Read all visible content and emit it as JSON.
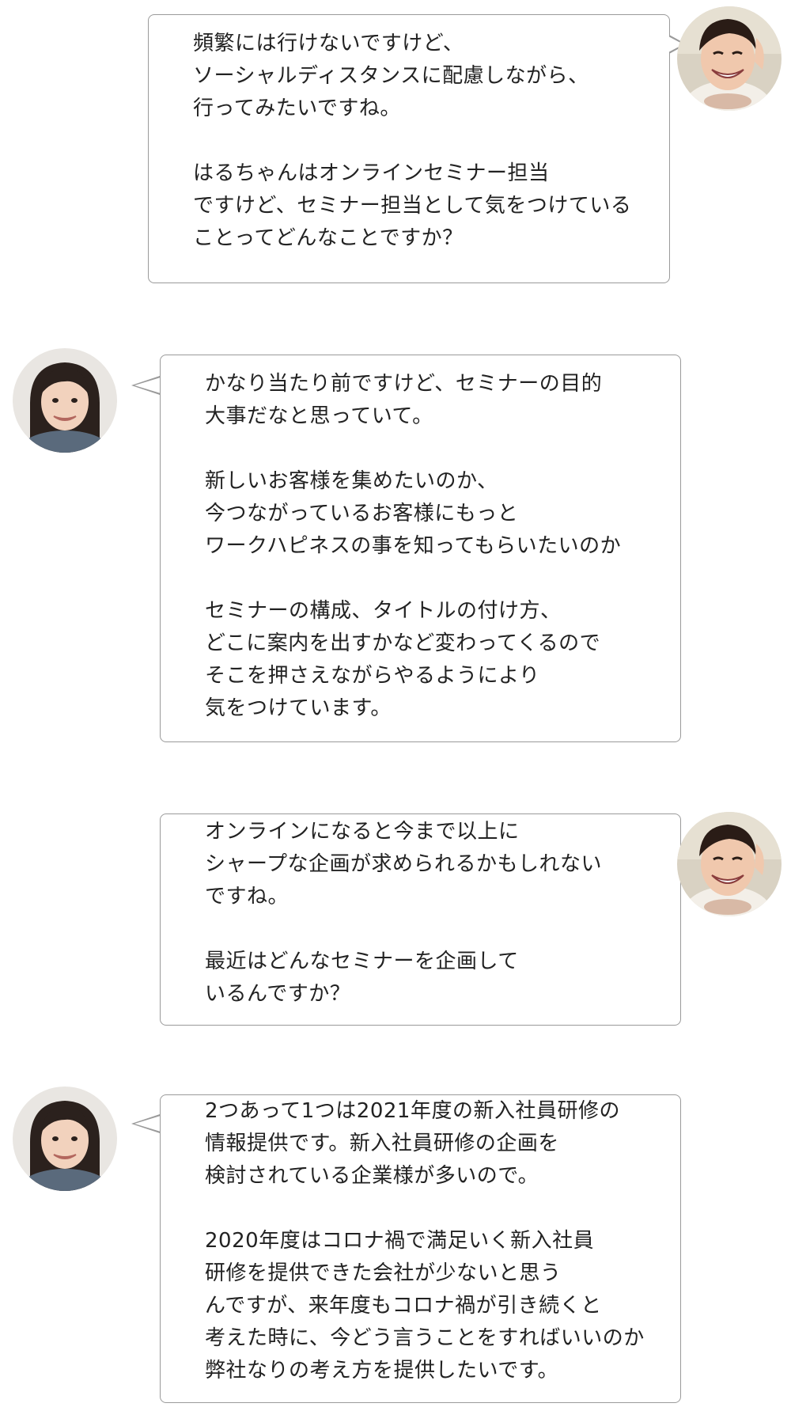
{
  "messages": [
    {
      "speaker": "interviewer",
      "lines": [
        "頻繁には行けないですけど、",
        "ソーシャルディスタンスに配慮しながら、",
        "行ってみたいですね。",
        "",
        "はるちゃんはオンラインセミナー担当",
        "ですけど、セミナー担当として気をつけている",
        "ことってどんなことですか？"
      ]
    },
    {
      "speaker": "haru",
      "lines": [
        "かなり当たり前ですけど、セミナーの目的",
        "大事だなと思っていて。",
        "",
        "新しいお客様を集めたいのか、",
        "今つながっているお客様にもっと",
        "ワークハピネスの事を知ってもらいたいのか",
        "",
        "セミナーの構成、タイトルの付け方、",
        "どこに案内を出すかなど変わってくるので",
        "そこを押さえながらやるようにより",
        "気をつけています。"
      ]
    },
    {
      "speaker": "interviewer",
      "lines": [
        "オンラインになると今まで以上に",
        "シャープな企画が求められるかもしれない",
        "ですね。",
        "",
        "最近はどんなセミナーを企画して",
        "いるんですか？"
      ]
    },
    {
      "speaker": "haru",
      "lines": [
        "2つあって1つは2021年度の新入社員研修の",
        "情報提供です。新入社員研修の企画を",
        "検討されている企業様が多いので。",
        "",
        "2020年度はコロナ禍で満足いく新入社員",
        "研修を提供できた会社が少ないと思う",
        "んですが、来年度もコロナ禍が引き続くと",
        "考えた時に、今どう言うことをすればいいのか",
        "弊社なりの考え方を提供したいです。"
      ]
    }
  ]
}
